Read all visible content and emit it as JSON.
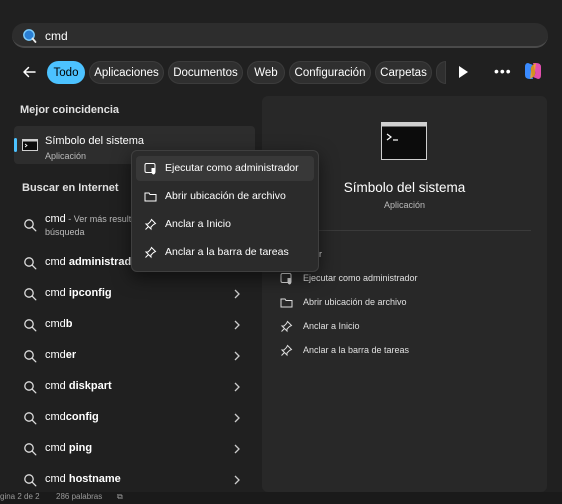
{
  "search": {
    "query": "cmd"
  },
  "filters": [
    {
      "label": "Todo",
      "active": true
    },
    {
      "label": "Aplicaciones",
      "active": false
    },
    {
      "label": "Documentos",
      "active": false
    },
    {
      "label": "Web",
      "active": false
    },
    {
      "label": "Configuración",
      "active": false
    },
    {
      "label": "Carpetas",
      "active": false
    }
  ],
  "best_match": {
    "section_title": "Mejor coincidencia",
    "name": "Símbolo del sistema",
    "type": "Aplicación"
  },
  "web": {
    "section_title": "Buscar en Internet",
    "first": {
      "prefix": "cmd",
      "hint": " - Ver más result",
      "line2": "búsqueda"
    },
    "items": [
      {
        "prefix": "cmd ",
        "bold": "administrador"
      },
      {
        "prefix": "cmd ",
        "bold": "ipconfig"
      },
      {
        "prefix": "cmd",
        "bold": "b"
      },
      {
        "prefix": "cmd",
        "bold": "er"
      },
      {
        "prefix": "cmd ",
        "bold": "diskpart"
      },
      {
        "prefix": "cmd",
        "bold": "config"
      },
      {
        "prefix": "cmd ",
        "bold": "ping"
      },
      {
        "prefix": "cmd ",
        "bold": "hostname"
      }
    ]
  },
  "context_menu": {
    "items": [
      {
        "label": "Ejecutar como administrador",
        "icon": "shield-run-icon"
      },
      {
        "label": "Abrir ubicación de archivo",
        "icon": "folder-icon"
      },
      {
        "label": "Anclar a Inicio",
        "icon": "pin-icon"
      },
      {
        "label": "Anclar a la barra de tareas",
        "icon": "pin-icon"
      }
    ]
  },
  "preview": {
    "title": "Símbolo del sistema",
    "subtitle": "Aplicación",
    "actions": [
      {
        "label": "Abrir",
        "icon": "open-icon"
      },
      {
        "label": "Ejecutar como administrador",
        "icon": "shield-run-icon"
      },
      {
        "label": "Abrir ubicación de archivo",
        "icon": "folder-icon"
      },
      {
        "label": "Anclar a Inicio",
        "icon": "pin-icon"
      },
      {
        "label": "Anclar a la barra de tareas",
        "icon": "pin-icon"
      }
    ]
  },
  "status": {
    "page": "gina 2 de 2",
    "words": "286 palabras"
  },
  "colors": {
    "accent": "#4cc2ff",
    "background": "#202020",
    "panel": "#282828"
  }
}
